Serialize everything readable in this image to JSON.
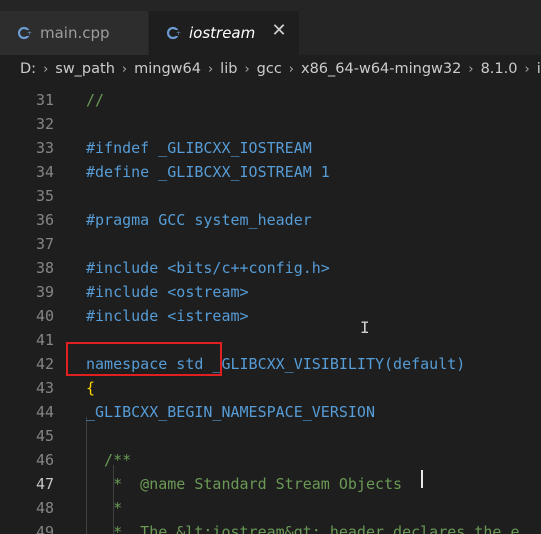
{
  "tabs": [
    {
      "label": "main.cpp",
      "icon": "cpp-file-icon",
      "active": false
    },
    {
      "label": "iostream",
      "icon": "cpp-file-icon",
      "active": true,
      "close": "✕"
    }
  ],
  "breadcrumb": [
    "D:",
    "sw_path",
    "mingw64",
    "lib",
    "gcc",
    "x86_64-w64-mingw32",
    "8.1.0",
    "in"
  ],
  "editor": {
    "lines": [
      {
        "n": "31",
        "text": "//"
      },
      {
        "n": "32",
        "text": ""
      },
      {
        "n": "33",
        "text": "#ifndef _GLIBCXX_IOSTREAM"
      },
      {
        "n": "34",
        "text": "#define _GLIBCXX_IOSTREAM 1"
      },
      {
        "n": "35",
        "text": ""
      },
      {
        "n": "36",
        "text": "#pragma GCC system_header"
      },
      {
        "n": "37",
        "text": ""
      },
      {
        "n": "38",
        "text": "#include <bits/c++config.h>"
      },
      {
        "n": "39",
        "text": "#include <ostream>"
      },
      {
        "n": "40",
        "text": "#include <istream>"
      },
      {
        "n": "41",
        "text": ""
      },
      {
        "n": "42",
        "text": "namespace std _GLIBCXX_VISIBILITY(default)"
      },
      {
        "n": "43",
        "text": "{"
      },
      {
        "n": "44",
        "text": "_GLIBCXX_BEGIN_NAMESPACE_VERSION"
      },
      {
        "n": "45",
        "text": ""
      },
      {
        "n": "46",
        "text": "  /**"
      },
      {
        "n": "47",
        "text": "   *  @name Standard Stream Objects"
      },
      {
        "n": "48",
        "text": "   *"
      },
      {
        "n": "49",
        "text": "   *  The &lt;iostream&gt; header declares the e"
      }
    ],
    "active_line": "47"
  },
  "colors": {
    "background": "#1e1e1e",
    "keyword": "#569cd6",
    "comment": "#6a9955",
    "string": "#ce9178",
    "highlight_box": "#e02020"
  }
}
